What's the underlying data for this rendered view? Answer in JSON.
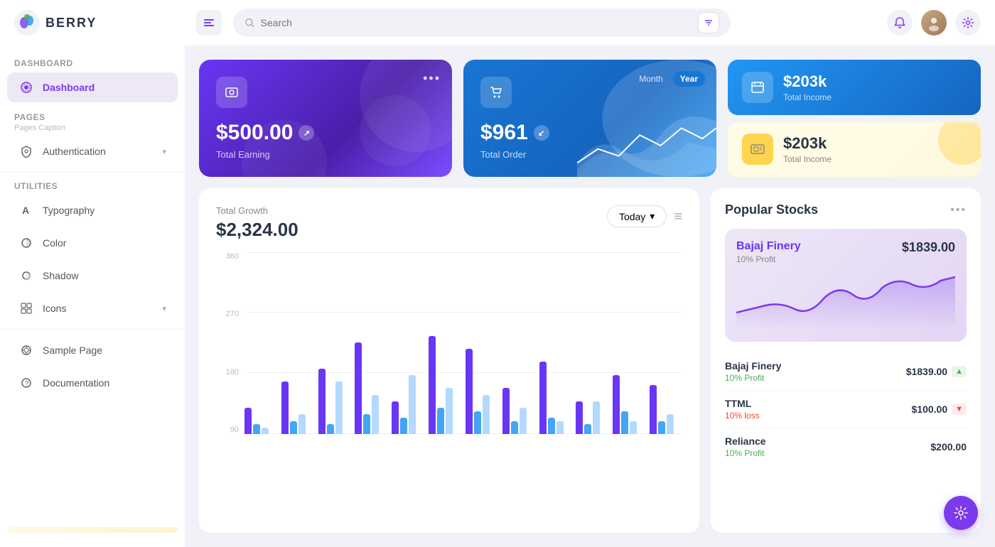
{
  "header": {
    "logo_text": "BERRY",
    "search_placeholder": "Search",
    "menu_icon": "☰"
  },
  "sidebar": {
    "section_dashboard": "Dashboard",
    "active_item": "Dashboard",
    "section_pages": "Pages",
    "pages_caption": "Pages Caption",
    "authentication_label": "Authentication",
    "section_utilities": "Utilities",
    "typography_label": "Typography",
    "color_label": "Color",
    "shadow_label": "Shadow",
    "icons_label": "Icons",
    "sample_page_label": "Sample Page",
    "documentation_label": "Documentation"
  },
  "cards": {
    "earning": {
      "amount": "$500.00",
      "label": "Total Earning"
    },
    "order": {
      "amount": "$961",
      "label": "Total Order",
      "toggle_month": "Month",
      "toggle_year": "Year"
    },
    "income1": {
      "amount": "$203k",
      "label": "Total Income"
    },
    "income2": {
      "amount": "$203k",
      "label": "Total Income"
    }
  },
  "chart": {
    "title": "Total Growth",
    "total": "$2,324.00",
    "today_label": "Today",
    "y_labels": [
      "360",
      "270",
      "180",
      "90"
    ],
    "bars": [
      {
        "purple": 40,
        "blue": 15,
        "light": 10
      },
      {
        "purple": 80,
        "blue": 20,
        "light": 30
      },
      {
        "purple": 100,
        "blue": 15,
        "light": 80
      },
      {
        "purple": 140,
        "blue": 30,
        "light": 60
      },
      {
        "purple": 50,
        "blue": 25,
        "light": 90
      },
      {
        "purple": 150,
        "blue": 40,
        "light": 70
      },
      {
        "purple": 130,
        "blue": 35,
        "light": 60
      },
      {
        "purple": 70,
        "blue": 20,
        "light": 40
      },
      {
        "purple": 110,
        "blue": 25,
        "light": 20
      },
      {
        "purple": 50,
        "blue": 15,
        "light": 50
      },
      {
        "purple": 90,
        "blue": 35,
        "light": 20
      },
      {
        "purple": 75,
        "blue": 20,
        "light": 30
      }
    ]
  },
  "stocks": {
    "title": "Popular Stocks",
    "featured": {
      "name": "Bajaj Finery",
      "profit_label": "10% Profit",
      "price": "$1839.00"
    },
    "list": [
      {
        "name": "Bajaj Finery",
        "sub": "10% Profit",
        "sub_type": "profit",
        "price": "$1839.00",
        "badge": "up"
      },
      {
        "name": "TTML",
        "sub": "10% loss",
        "sub_type": "loss",
        "price": "$100.00",
        "badge": "down"
      },
      {
        "name": "Reliance",
        "sub": "10% Profit",
        "sub_type": "profit",
        "price": "$200.00",
        "badge": ""
      }
    ]
  }
}
